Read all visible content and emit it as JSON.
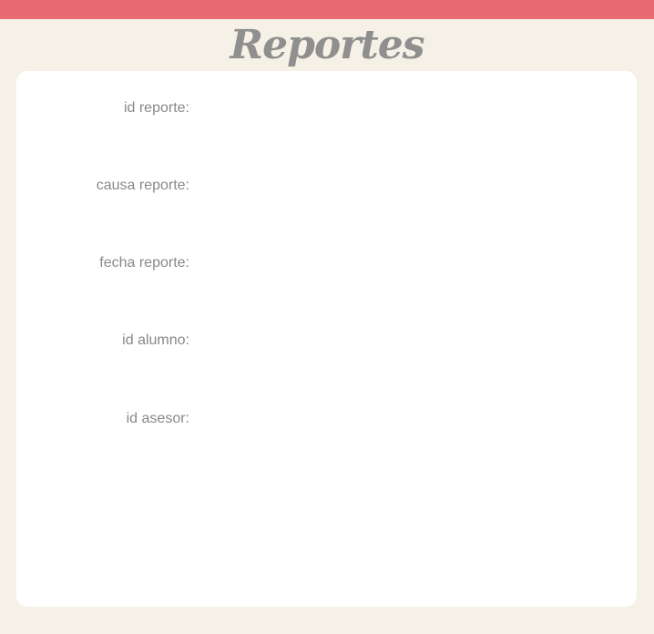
{
  "header": {
    "title": "Reportes",
    "accent_color": "#ea6a74",
    "background_color": "#f6f1e6"
  },
  "report": {
    "fields": [
      {
        "label": "id reporte:",
        "value": ""
      },
      {
        "label": "causa reporte:",
        "value": ""
      },
      {
        "label": "fecha reporte:",
        "value": ""
      },
      {
        "label": "id alumno:",
        "value": ""
      },
      {
        "label": "id asesor:",
        "value": ""
      }
    ]
  }
}
